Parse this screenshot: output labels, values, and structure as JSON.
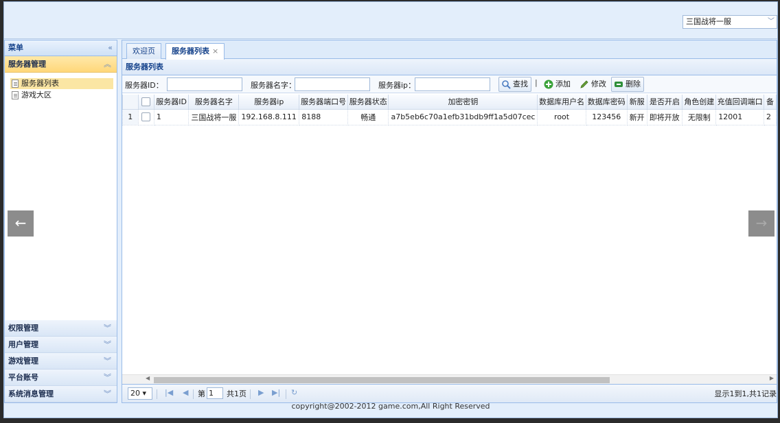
{
  "header": {
    "server_select": "三国战将一服"
  },
  "west": {
    "title": "菜单",
    "collapse_icon": "«",
    "open_section": {
      "label": "服务器管理",
      "chevron": "︽",
      "items": [
        {
          "label": "服务器列表",
          "selected": true
        },
        {
          "label": "游戏大区",
          "selected": false
        }
      ]
    },
    "sections": [
      {
        "label": "权限管理"
      },
      {
        "label": "用户管理"
      },
      {
        "label": "游戏管理"
      },
      {
        "label": "平台账号"
      },
      {
        "label": "系统消息管理"
      }
    ],
    "section_chevron": "︾"
  },
  "tabs": [
    {
      "label": "欢迎页"
    },
    {
      "label": "服务器列表",
      "close": "×"
    }
  ],
  "panel": {
    "title": "服务器列表"
  },
  "search": {
    "id_label": "服务器ID：",
    "name_label": "服务器名字：",
    "ip_label": "服务器ip：",
    "find": "查找",
    "add": "添加",
    "edit": "修改",
    "delete": "删除",
    "sep": "|"
  },
  "grid": {
    "columns": [
      "服务器ID",
      "服务器名字",
      "服务器ip",
      "服务器端口号",
      "服务器状态",
      "加密密钥",
      "数据库用户名",
      "数据库密码",
      "新服",
      "是否开启",
      "角色创建",
      "充值回调端口",
      "备"
    ],
    "rows": [
      {
        "num": "1",
        "cells": [
          "1",
          "三国战将一服",
          "192.168.8.111",
          "8188",
          "畅通",
          "a7b5eb6c70a1efb31bdb9ff1a5d07cec",
          "root",
          "123456",
          "新开",
          "即将开放",
          "无限制",
          "12001",
          "2"
        ]
      }
    ]
  },
  "pager": {
    "size": "20 ▾",
    "page_prefix": "第",
    "page": "1",
    "page_suffix": "共1页",
    "summary": "显示1到1,共1记录"
  },
  "slider": {
    "prev": "←",
    "next": "→"
  },
  "footer": "copyright@2002-2012 game.com,All Right Reserved"
}
